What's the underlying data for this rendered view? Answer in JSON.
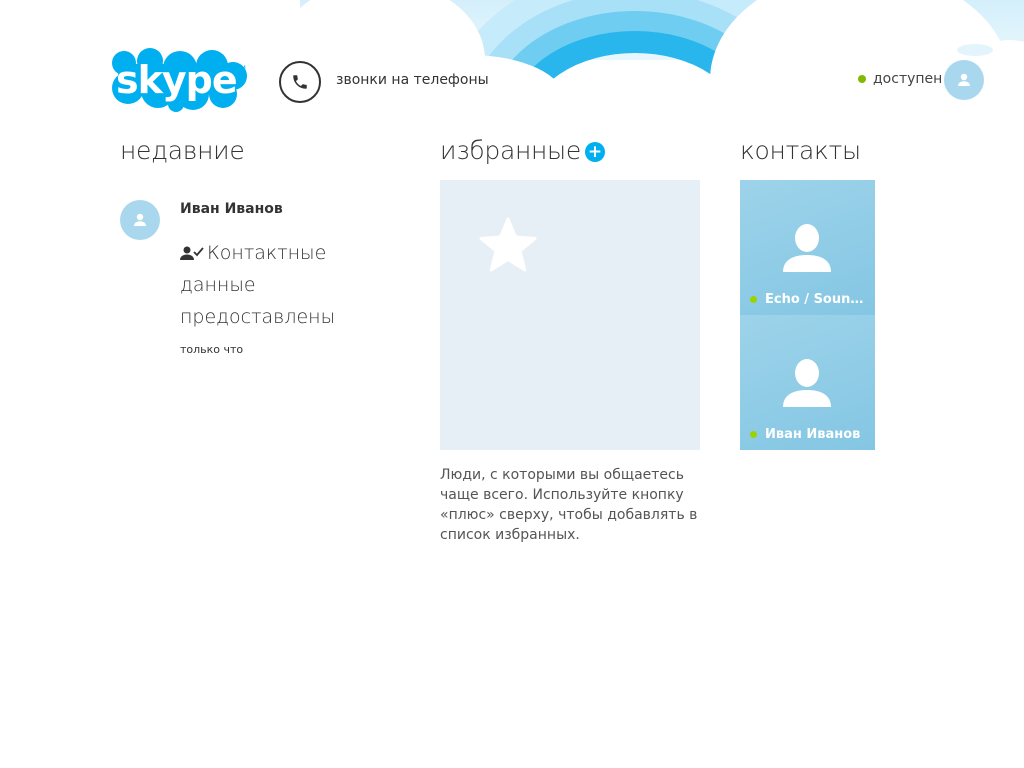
{
  "brand": {
    "logo_text": "skype",
    "accent": "#00aff0",
    "status_green": "#7fba00"
  },
  "header": {
    "call_phones_label": "звонки на телефоны",
    "phone_icon": "phone-icon",
    "status_text": "доступен"
  },
  "recent": {
    "title": "недавние",
    "items": [
      {
        "name": "Иван Иванов",
        "message_icon": "contact-accepted-icon",
        "message": "Контактные данные предоставлены",
        "time": "только что"
      }
    ]
  },
  "favorites": {
    "title": "избранные",
    "add_icon": "plus-icon",
    "add_symbol": "+",
    "empty_icon": "star-icon",
    "description": "Люди, с которыми вы общаетесь чаще всего. Используйте кнопку «плюс» сверху, чтобы добавлять в список избранных."
  },
  "contacts": {
    "title": "контакты",
    "items": [
      {
        "name": "Echo / Soun…",
        "status": "online"
      },
      {
        "name": "Иван Иванов",
        "status": "online"
      }
    ]
  }
}
